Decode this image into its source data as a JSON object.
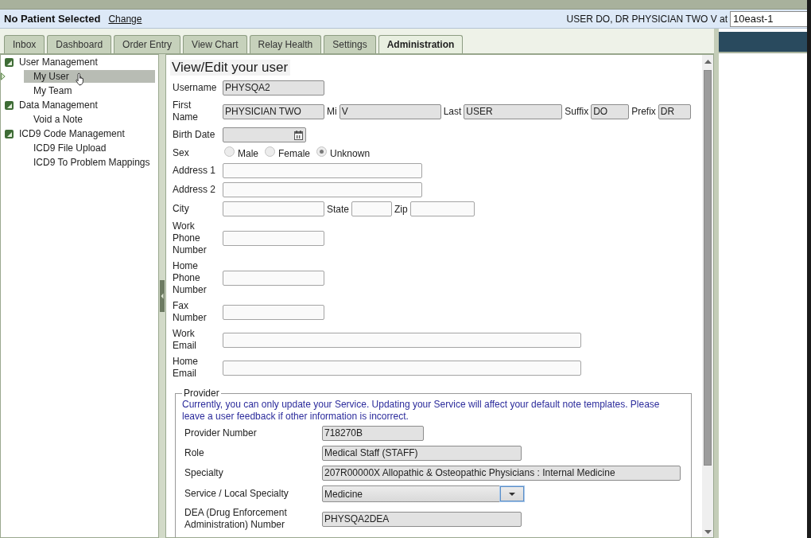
{
  "header": {
    "patient": "No Patient Selected",
    "change_link": "Change",
    "user": "USER DO, DR PHYSICIAN TWO V at",
    "location": "10east-1"
  },
  "tabs": [
    {
      "label": "Inbox",
      "selected": false
    },
    {
      "label": "Dashboard",
      "selected": false
    },
    {
      "label": "Order Entry",
      "selected": false
    },
    {
      "label": "View Chart",
      "selected": false
    },
    {
      "label": "Relay Health",
      "selected": false
    },
    {
      "label": "Settings",
      "selected": false
    },
    {
      "label": "Administration",
      "selected": true
    }
  ],
  "sidebar": {
    "items": [
      {
        "label": "User Management",
        "expanded": true,
        "selected": false,
        "children": [
          {
            "label": "My User",
            "selected": true
          },
          {
            "label": "My Team",
            "selected": false
          }
        ]
      },
      {
        "label": "Data Management",
        "expanded": true,
        "selected": false,
        "children": [
          {
            "label": "Void a Note",
            "selected": false
          }
        ]
      },
      {
        "label": "ICD9 Code Management",
        "expanded": true,
        "selected": false,
        "children": [
          {
            "label": "ICD9 File Upload",
            "selected": false
          },
          {
            "label": "ICD9 To Problem Mappings",
            "selected": false
          }
        ]
      }
    ]
  },
  "form": {
    "title": "View/Edit your user",
    "rows": [
      {
        "label": "Username",
        "fields": [
          {
            "kind": "text",
            "value": "PHYSQA2",
            "disabled": true
          }
        ]
      },
      {
        "label": "First Name",
        "fields": [
          {
            "kind": "text",
            "value": "PHYSICIAN TWO",
            "disabled": true
          },
          {
            "kind": "text",
            "label": "Mi",
            "value": "V",
            "disabled": true
          },
          {
            "kind": "text",
            "label": "Last",
            "value": "USER",
            "disabled": true
          },
          {
            "kind": "text",
            "label": "Suffix",
            "value": "DO",
            "disabled": true
          },
          {
            "kind": "text",
            "label": "Prefix",
            "value": "DR",
            "disabled": true
          }
        ]
      },
      {
        "label": "Birth Date",
        "fields": [
          {
            "kind": "date",
            "disabled": true
          }
        ]
      },
      {
        "label": "Sex",
        "fields": [
          {
            "kind": "radio",
            "label": "Male",
            "selected": false,
            "disabled": true
          },
          {
            "kind": "radio",
            "label": "Female",
            "selected": false,
            "disabled": true
          },
          {
            "kind": "radio",
            "label": "Unknown",
            "selected": true,
            "disabled": true
          }
        ]
      },
      {
        "label": "Address 1",
        "fields": [
          {
            "kind": "text",
            "disabled": false
          }
        ]
      },
      {
        "label": "Address 2",
        "fields": [
          {
            "kind": "text",
            "disabled": false
          }
        ]
      },
      {
        "label": "City",
        "fields": [
          {
            "kind": "text",
            "disabled": false
          },
          {
            "kind": "text",
            "label": "State",
            "disabled": false
          },
          {
            "kind": "text",
            "label": "Zip",
            "disabled": false
          }
        ]
      },
      {
        "label": "Work Phone Number",
        "fields": [
          {
            "kind": "text",
            "disabled": false
          }
        ]
      },
      {
        "label": "Home Phone Number",
        "fields": [
          {
            "kind": "text",
            "disabled": false
          }
        ]
      },
      {
        "label": "Fax Number",
        "fields": [
          {
            "kind": "text",
            "disabled": false
          }
        ]
      },
      {
        "label": "Work Email",
        "fields": [
          {
            "kind": "text",
            "disabled": false
          }
        ]
      },
      {
        "label": "Home Email",
        "fields": [
          {
            "kind": "text",
            "disabled": false
          }
        ]
      }
    ]
  },
  "provider": {
    "legend": "Provider",
    "notice": "Currently, you can only update your Service. Updating your Service will affect your default note templates. Please leave a user feedback if other information is incorrect.",
    "rows": [
      {
        "label": "Provider Number",
        "fields": [
          {
            "kind": "text",
            "value": "718270B",
            "disabled": true
          }
        ]
      },
      {
        "label": "Role",
        "fields": [
          {
            "kind": "text",
            "value": "Medical Staff (STAFF)",
            "disabled": true
          }
        ]
      },
      {
        "label": "Specialty",
        "fields": [
          {
            "kind": "text",
            "value": "207R00000X Allopathic & Osteopathic Physicians : Internal Medicine",
            "disabled": true
          }
        ]
      },
      {
        "label": "Service / Local Specialty",
        "fields": [
          {
            "kind": "select",
            "value": "Medicine",
            "disabled": false,
            "focused": true
          }
        ]
      },
      {
        "label": "DEA (Drug Enforcement Administration) Number",
        "fields": [
          {
            "kind": "text",
            "value": "PHYSQA2DEA",
            "disabled": true
          }
        ]
      }
    ]
  }
}
